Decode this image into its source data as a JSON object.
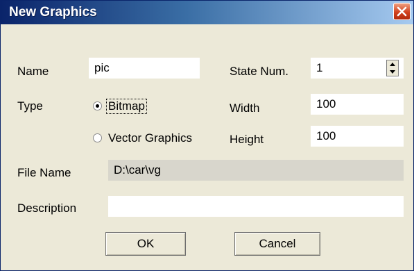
{
  "dialog": {
    "title": "New Graphics"
  },
  "form": {
    "name_label": "Name",
    "name_value": "pic",
    "state_num_label": "State Num.",
    "state_num_value": "1",
    "type_label": "Type",
    "type_options": [
      "Bitmap",
      "Vector Graphics"
    ],
    "type_selected": "Bitmap",
    "width_label": "Width",
    "width_value": "100",
    "height_label": "Height",
    "height_value": "100",
    "file_name_label": "File Name",
    "file_name_value": "D:\\car\\vg",
    "description_label": "Description",
    "description_value": ""
  },
  "buttons": {
    "ok": "OK",
    "cancel": "Cancel"
  },
  "icons": {
    "close": "close-icon",
    "spin_up": "spin-up-icon",
    "spin_down": "spin-down-icon"
  },
  "colors": {
    "title_bar_start": "#0a246a",
    "close_button": "#d1411e",
    "dialog_bg": "#ece9d8"
  }
}
